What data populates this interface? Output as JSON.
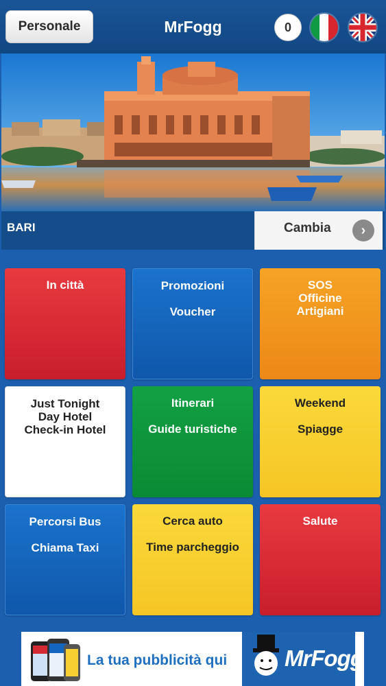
{
  "header": {
    "personal_button": "Personale",
    "title": "MrFogg",
    "counter": "0",
    "flag_italian": "flag-it-icon",
    "flag_english": "flag-uk-icon"
  },
  "city": {
    "name": "BARI",
    "change_button": "Cambia",
    "change_icon": "chevron-right-icon"
  },
  "tiles": [
    {
      "id": "in-citta",
      "color": "#d42a34",
      "lines": [
        "In città"
      ]
    },
    {
      "id": "promozioni",
      "color": "#1465bd",
      "lines": [
        "Promozioni",
        "Voucher"
      ]
    },
    {
      "id": "sos",
      "color": "#f19a1f",
      "lines": [
        "SOS",
        "Officine",
        "Artigiani"
      ]
    },
    {
      "id": "hotel",
      "color": "#ffffff",
      "lines": [
        "Just Tonight",
        "Day Hotel",
        "Check-in Hotel"
      ]
    },
    {
      "id": "itinerari",
      "color": "#0f963c",
      "lines": [
        "Itinerari",
        "Guide turistiche"
      ]
    },
    {
      "id": "weekend",
      "color": "#f8cf30",
      "lines": [
        "Weekend",
        "Spiagge"
      ]
    },
    {
      "id": "bus",
      "color": "#1465bd",
      "lines": [
        "Percorsi Bus",
        "Chiama Taxi"
      ]
    },
    {
      "id": "auto",
      "color": "#f8cf30",
      "lines": [
        "Cerca auto",
        "Time parcheggio"
      ]
    },
    {
      "id": "salute",
      "color": "#d42a34",
      "lines": [
        "Salute"
      ]
    }
  ],
  "ad": {
    "text": "La tua pubblicità qui",
    "logo_text": "MrFogg"
  },
  "colors": {
    "background": "#1c5fae",
    "header": "#134e8c",
    "city_bar": "#154c8a"
  }
}
